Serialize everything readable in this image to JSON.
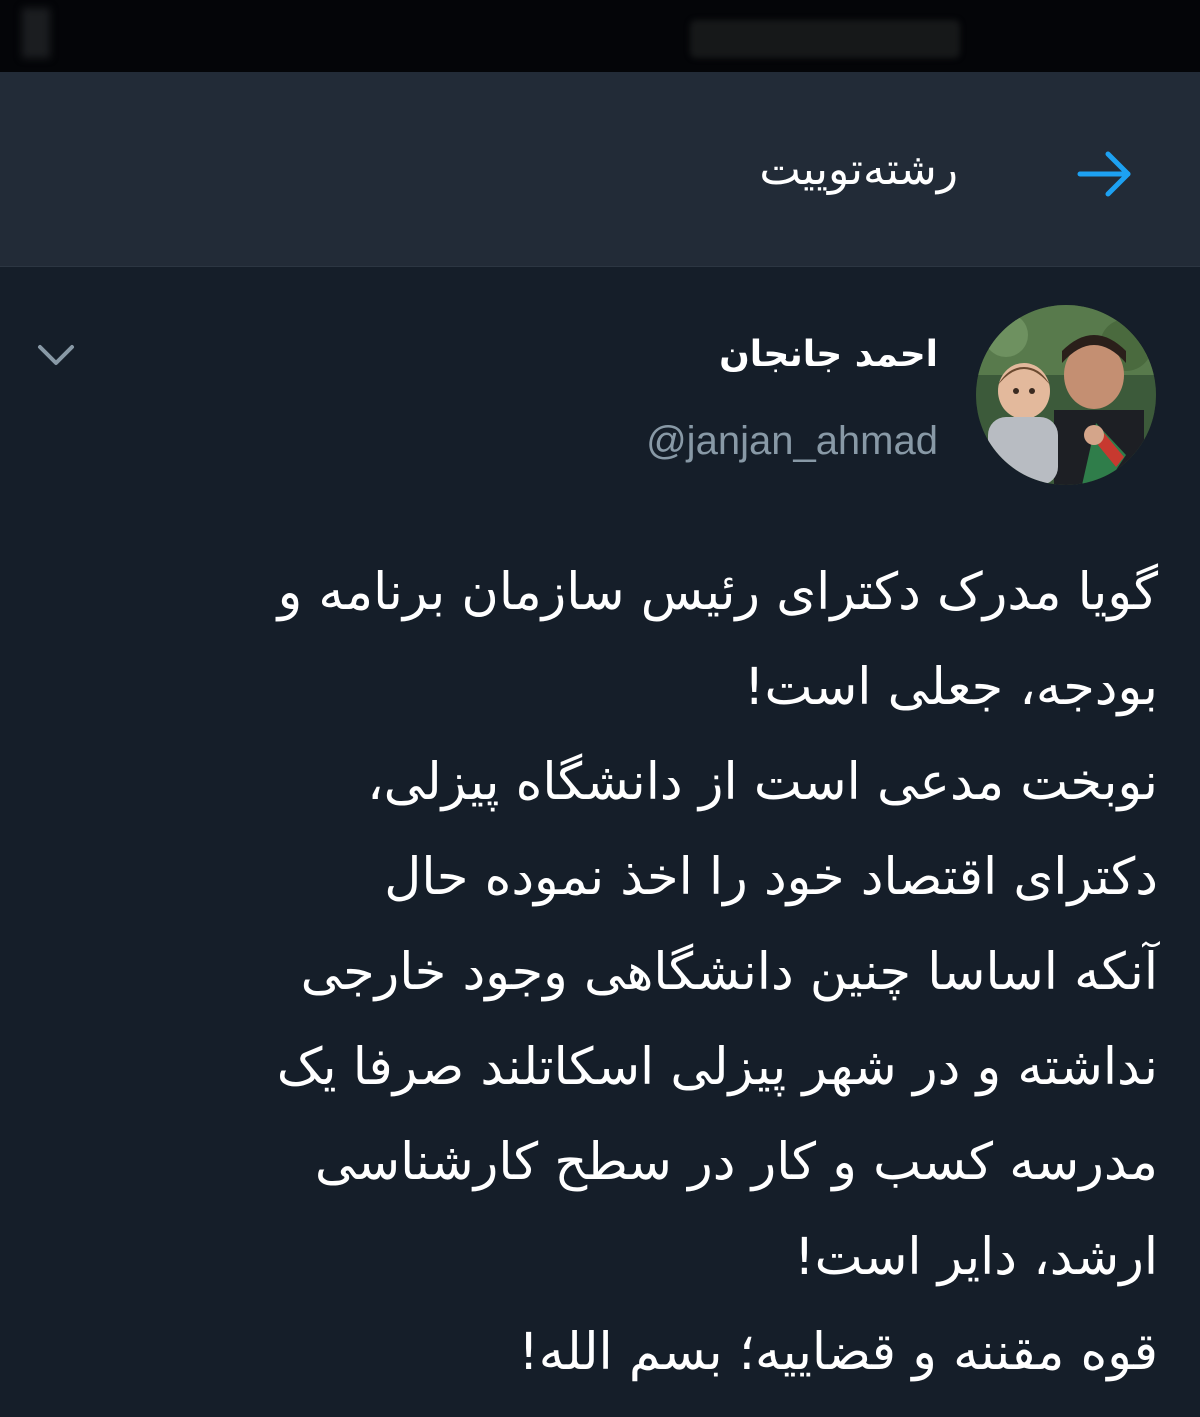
{
  "header": {
    "title": "رشته‌توییت",
    "back_icon": "arrow-right-icon",
    "accent_color": "#1da1f2"
  },
  "tweet": {
    "author": {
      "display_name": "احمد جانجان",
      "handle": "@janjan_ahmad"
    },
    "menu_icon": "chevron-down-icon",
    "lines": [
      "گویا مدرک دکترای رئیس سازمان برنامه و",
      "بودجه، جعلی است!",
      "نوبخت مدعی است از دانشگاه پیزلی،",
      "دکترای اقتصاد خود را اخذ نموده حال",
      "آنکه اساسا چنین دانشگاهی وجود خارجی",
      "نداشته و در شهر پیزلی اسکاتلند صرفا یک",
      "مدرسه کسب و کار در سطح کارشناسی",
      "ارشد، دایر است!",
      "قوه مقننه و قضاییه؛ بسم الله!"
    ]
  }
}
